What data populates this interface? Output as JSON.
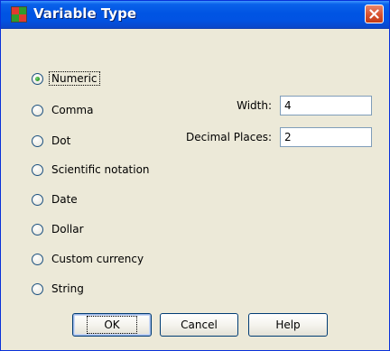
{
  "window": {
    "title": "Variable Type",
    "close_icon": "close-icon"
  },
  "colors": {
    "title_bar": "#0054e3",
    "dialog_bg": "#ece9d8",
    "close_red": "#d8522f",
    "radio_green": "#2f9c2b"
  },
  "variable_type_options": [
    {
      "label": "Numeric",
      "selected": true
    },
    {
      "label": "Comma",
      "selected": false
    },
    {
      "label": "Dot",
      "selected": false
    },
    {
      "label": "Scientific notation",
      "selected": false
    },
    {
      "label": "Date",
      "selected": false
    },
    {
      "label": "Dollar",
      "selected": false
    },
    {
      "label": "Custom currency",
      "selected": false
    },
    {
      "label": "String",
      "selected": false
    }
  ],
  "fields": {
    "width": {
      "label": "Width:",
      "value": "4"
    },
    "decimal_places": {
      "label": "Decimal Places:",
      "value": "2"
    }
  },
  "buttons": {
    "ok": "OK",
    "cancel": "Cancel",
    "help": "Help"
  }
}
